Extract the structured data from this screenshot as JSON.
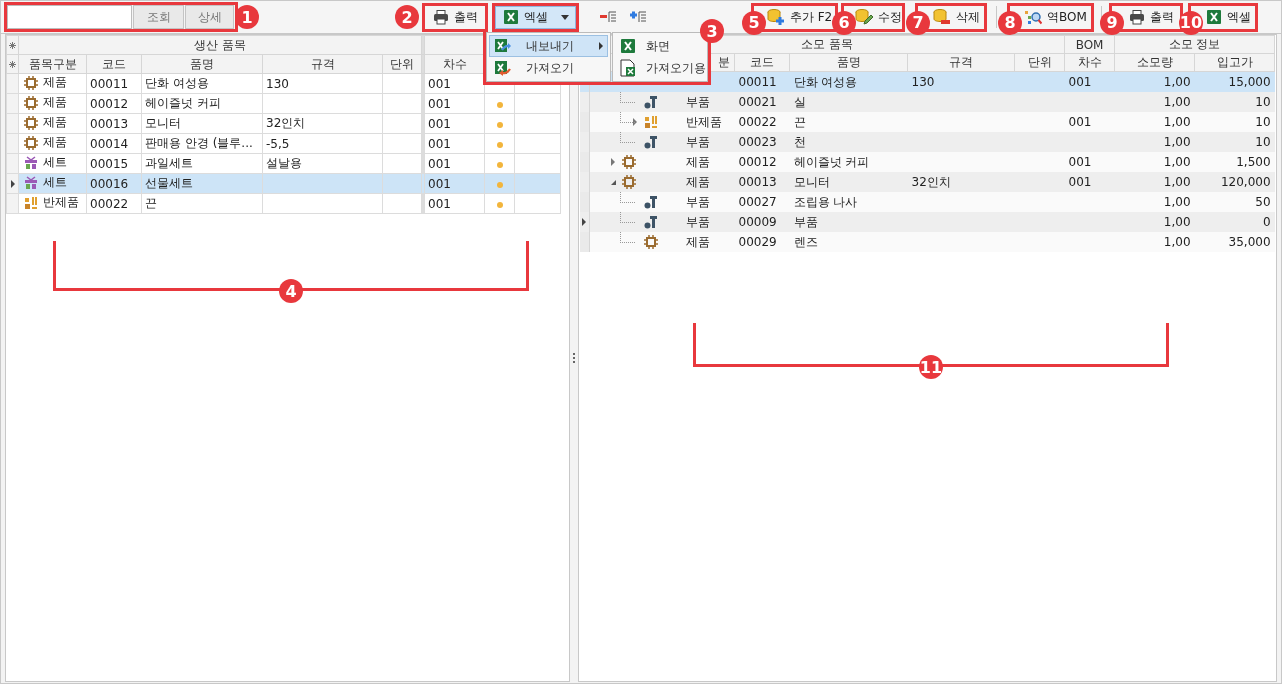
{
  "search_bar": {
    "buttons": [
      {
        "label": "조회"
      },
      {
        "label": "상세"
      }
    ],
    "callout": "1"
  },
  "toolbar": {
    "left_buttons": [
      {
        "kind": "print",
        "label": "출력",
        "callout": "2"
      },
      {
        "kind": "excel",
        "label": "엑셀",
        "open": true
      },
      {
        "kind": "collapse"
      },
      {
        "kind": "expand"
      }
    ],
    "right_buttons": [
      {
        "kind": "add",
        "label": "추가 F2",
        "callout": "5"
      },
      {
        "kind": "edit",
        "label": "수정",
        "callout": "6"
      },
      {
        "kind": "delete",
        "label": "삭제",
        "callout": "7"
      },
      {
        "kind": "separator"
      },
      {
        "kind": "reverse_bom",
        "label": "역BOM",
        "callout": "8"
      },
      {
        "kind": "separator"
      },
      {
        "kind": "print",
        "label": "출력",
        "callout": "9"
      },
      {
        "kind": "excel",
        "label": "엑셀",
        "callout": "10"
      }
    ]
  },
  "export_menu": {
    "items": [
      {
        "kind": "export",
        "label": "내보내기",
        "selected": true,
        "submenu": true
      },
      {
        "kind": "import",
        "label": "가져오기",
        "selected": false
      }
    ],
    "submenu": [
      {
        "kind": "screen",
        "label": "화면"
      },
      {
        "kind": "import_form",
        "label": "가져오기용"
      }
    ],
    "callout": "3"
  },
  "production_grid": {
    "title": "생산 품목",
    "columns": [
      "품목구분",
      "코드",
      "품명",
      "규격",
      "단위"
    ],
    "extra_columns": [
      "차수"
    ],
    "callout": "4",
    "rows": [
      {
        "kind": "product",
        "type": "제품",
        "code": "00011",
        "name": "단화 여성용",
        "spec": "130",
        "revision": "001",
        "dot": false,
        "selected": false
      },
      {
        "kind": "product",
        "type": "제품",
        "code": "00012",
        "name": "헤이즐넛 커피",
        "revision": "001",
        "dot": true,
        "selected": false
      },
      {
        "kind": "product",
        "type": "제품",
        "code": "00013",
        "name": "모니터",
        "spec": "32인치",
        "revision": "001",
        "dot": true,
        "selected": false
      },
      {
        "kind": "product",
        "type": "제품",
        "code": "00014",
        "name": "판매용 안경 (블루...",
        "spec": "-5,5",
        "revision": "001",
        "dot": true,
        "selected": false
      },
      {
        "kind": "set",
        "type": "세트",
        "code": "00015",
        "name": "과일세트",
        "spec": "설날용",
        "revision": "001",
        "dot": true,
        "selected": false
      },
      {
        "kind": "set",
        "type": "세트",
        "code": "00016",
        "name": "선물세트",
        "revision": "001",
        "dot": true,
        "selected": true
      },
      {
        "kind": "semi",
        "type": "반제품",
        "code": "00022",
        "name": "끈",
        "revision": "001",
        "dot": true,
        "selected": false
      }
    ]
  },
  "bom_grid": {
    "groups": [
      "소모 품목",
      "BOM",
      "소모 정보"
    ],
    "columns": [
      "분",
      "코드",
      "품명",
      "규격",
      "단위",
      "차수",
      "소모량",
      "입고가"
    ],
    "callout": "11",
    "rows": [
      {
        "code": "00011",
        "name": "단화 여성용",
        "spec": "130",
        "revision": "001",
        "qty": "1,00",
        "price": "15,000",
        "selected": true,
        "current": false,
        "expanded": true,
        "children": [
          {
            "kind": "part",
            "type": "부품",
            "code": "00021",
            "name": "실",
            "qty": "1,00",
            "price": "10",
            "selected": false,
            "current": false
          },
          {
            "kind": "semi",
            "type": "반제품",
            "code": "00022",
            "name": "끈",
            "revision": "001",
            "qty": "1,00",
            "price": "10",
            "selected": false,
            "current": false,
            "expanded": false
          },
          {
            "kind": "part",
            "type": "부품",
            "code": "00023",
            "name": "천",
            "qty": "1,00",
            "price": "10",
            "selected": false,
            "current": false
          }
        ]
      },
      {
        "kind": "product",
        "type": "제품",
        "code": "00012",
        "name": "헤이즐넛 커피",
        "revision": "001",
        "qty": "1,00",
        "price": "1,500",
        "selected": false,
        "current": false,
        "expanded": false
      },
      {
        "kind": "product",
        "type": "제품",
        "code": "00013",
        "name": "모니터",
        "spec": "32인치",
        "revision": "001",
        "qty": "1,00",
        "price": "120,000",
        "selected": false,
        "current": false,
        "expanded": true,
        "children": [
          {
            "kind": "part",
            "type": "부품",
            "code": "00027",
            "name": "조립용 나사",
            "qty": "1,00",
            "price": "50",
            "selected": false,
            "current": false
          },
          {
            "kind": "part",
            "type": "부품",
            "code": "00009",
            "name": "부품",
            "qty": "1,00",
            "price": "0",
            "selected": false,
            "current": true
          },
          {
            "kind": "product",
            "type": "제품",
            "code": "00029",
            "name": "렌즈",
            "qty": "1,00",
            "price": "35,000",
            "selected": false,
            "current": false
          }
        ]
      }
    ]
  }
}
